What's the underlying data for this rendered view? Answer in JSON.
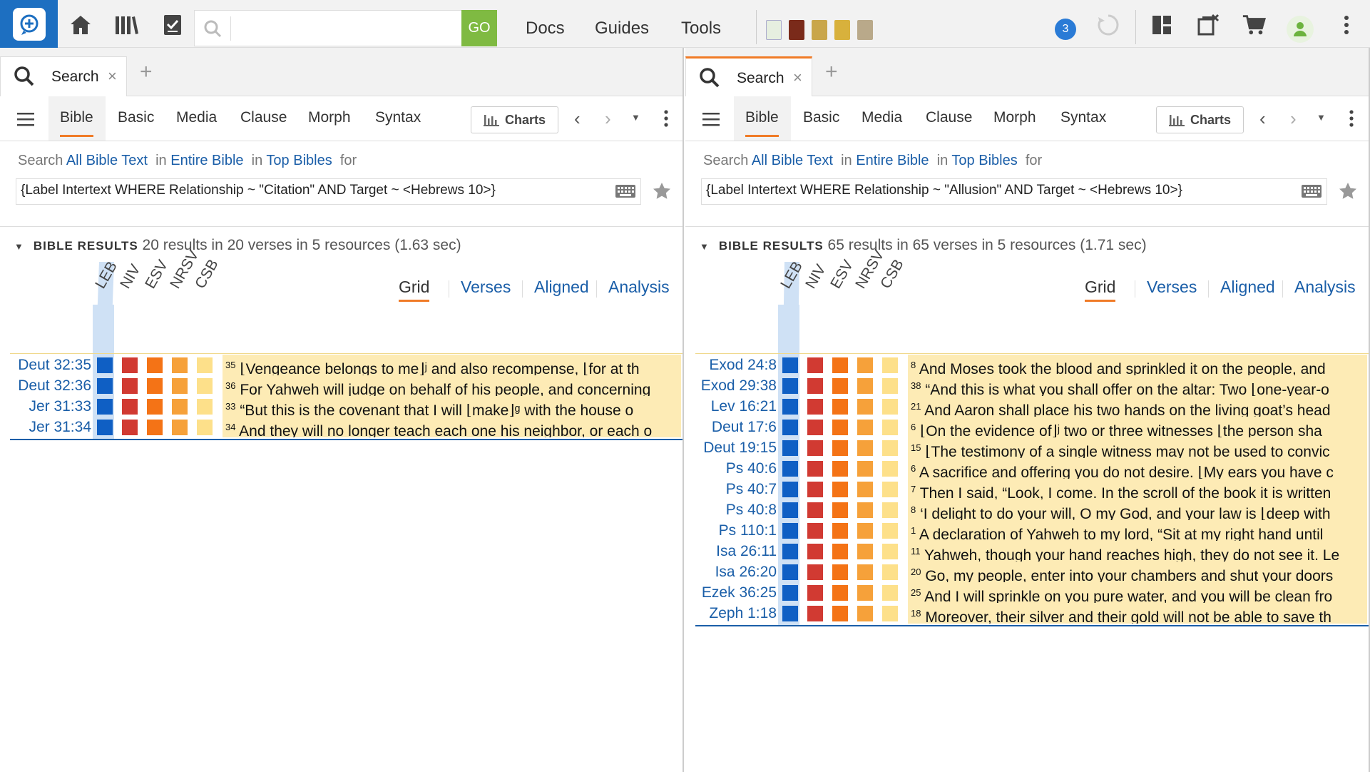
{
  "toolbar": {
    "search_placeholder": "",
    "go_label": "GO",
    "nav": [
      "Docs",
      "Guides",
      "Tools"
    ],
    "badge_count": "3"
  },
  "colors": {
    "accent": "#f07b27",
    "link": "#1a5ea8",
    "leb": "#0f5fc4",
    "niv": "#d13a32",
    "esv": "#f47316",
    "nrsv": "#f6a13a",
    "csb": "#fde08a",
    "verse_bg": "#fdebb5"
  },
  "panels": [
    {
      "tab_title": "Search",
      "subtabs": [
        "Bible",
        "Basic",
        "Media",
        "Clause",
        "Morph",
        "Syntax"
      ],
      "charts_label": "Charts",
      "scope": {
        "search": "Search",
        "all_text": "All Bible Text",
        "in1": "in",
        "entire": "Entire Bible",
        "in2": "in",
        "top": "Top Bibles",
        "for": "for"
      },
      "query": "{Label Intertext WHERE Relationship ~ \"Citation\" AND Target ~ <Hebrews 10>}",
      "results_caption": "BIBLE RESULTS",
      "results_summary": "20 results in 20 verses in 5 resources (1.63 sec)",
      "views": [
        "Grid",
        "Verses",
        "Aligned",
        "Analysis"
      ],
      "columns": [
        "LEB",
        "NIV",
        "ESV",
        "NRSV",
        "CSB"
      ],
      "rows": [
        {
          "ref": "Deut 32:35",
          "num": "35",
          "text": "⌊Vengeance belongs to me⌋ʲ and also recompense, ⌊for at th"
        },
        {
          "ref": "Deut 32:36",
          "num": "36",
          "text": "For Yahweh will judge on behalf of his people, and concerning"
        },
        {
          "ref": "Jer 31:33",
          "num": "33",
          "text": "“But this is the covenant that I will ⌊make⌋ᵍ with the house o"
        },
        {
          "ref": "Jer 31:34",
          "num": "34",
          "text": "And they will no longer teach each one his neighbor, or each o"
        }
      ]
    },
    {
      "tab_title": "Search",
      "subtabs": [
        "Bible",
        "Basic",
        "Media",
        "Clause",
        "Morph",
        "Syntax"
      ],
      "charts_label": "Charts",
      "scope": {
        "search": "Search",
        "all_text": "All Bible Text",
        "in1": "in",
        "entire": "Entire Bible",
        "in2": "in",
        "top": "Top Bibles",
        "for": "for"
      },
      "query": "{Label Intertext WHERE Relationship ~ \"Allusion\" AND Target ~ <Hebrews 10>}",
      "results_caption": "BIBLE RESULTS",
      "results_summary": "65 results in 65 verses in 5 resources (1.71 sec)",
      "views": [
        "Grid",
        "Verses",
        "Aligned",
        "Analysis"
      ],
      "columns": [
        "LEB",
        "NIV",
        "ESV",
        "NRSV",
        "CSB"
      ],
      "rows": [
        {
          "ref": "Exod 24:8",
          "num": "8",
          "text": "And Moses took the blood and sprinkled it on the people, and"
        },
        {
          "ref": "Exod 29:38",
          "num": "38",
          "text": "“And this is what you shall offer on the altar: Two ⌊one-year-o"
        },
        {
          "ref": "Lev 16:21",
          "num": "21",
          "text": "And Aaron shall place his two hands on the living goat’s head"
        },
        {
          "ref": "Deut 17:6",
          "num": "6",
          "text": "⌊On the evidence of⌋ʲ two or three witnesses ⌊the person sha"
        },
        {
          "ref": "Deut 19:15",
          "num": "15",
          "text": "⌊The testimony of a single witness may not be used to convic"
        },
        {
          "ref": "Ps 40:6",
          "num": "6",
          "text": "A sacrifice and offering you do not desire. ⌊My ears you have c"
        },
        {
          "ref": "Ps 40:7",
          "num": "7",
          "text": "Then I said, “Look, I come. In the scroll of the book it is written"
        },
        {
          "ref": "Ps 40:8",
          "num": "8",
          "text": "‘I delight to do your will, O my God, and your law is ⌊deep with"
        },
        {
          "ref": "Ps 110:1",
          "num": "1",
          "text": "A declaration of Yahweh to my lord, “Sit at my right hand until"
        },
        {
          "ref": "Isa 26:11",
          "num": "11",
          "text": "Yahweh, though your hand reaches high, they do not see it. Le"
        },
        {
          "ref": "Isa 26:20",
          "num": "20",
          "text": "Go, my people, enter into your chambers and shut your doors"
        },
        {
          "ref": "Ezek 36:25",
          "num": "25",
          "text": "And I will sprinkle on you pure water, and you will be clean fro"
        },
        {
          "ref": "Zeph 1:18",
          "num": "18",
          "text": "Moreover, their silver and their gold will not be able to save th"
        }
      ]
    }
  ]
}
